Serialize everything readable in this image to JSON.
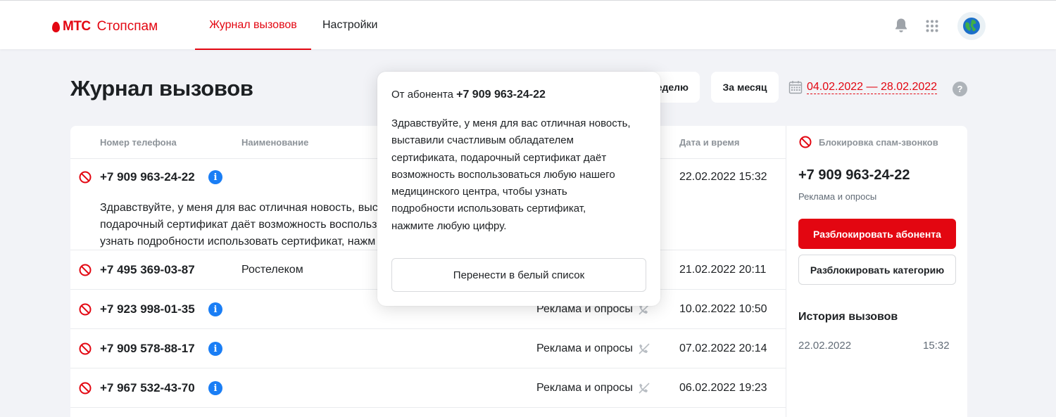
{
  "header": {
    "brand": "МТС",
    "product": "Стопспам",
    "nav": [
      {
        "label": "Журнал вызовов",
        "active": true
      },
      {
        "label": "Настройки",
        "active": false
      }
    ],
    "icons": [
      "bell-icon",
      "apps-grid-icon",
      "globe-avatar-icon"
    ]
  },
  "page": {
    "title": "Журнал вызовов",
    "filters": {
      "week_label": "За неделю",
      "week_label_visible": "еделю",
      "month_label": "За месяц"
    },
    "date_range": "04.02.2022 — 28.02.2022",
    "help": "?"
  },
  "table": {
    "columns": {
      "phone": "Номер телефона",
      "name": "Наименование",
      "datetime": "Дата и время"
    },
    "rows": [
      {
        "phone": "+7 909 963-24-22",
        "name": "",
        "category": "",
        "datetime": "22.02.2022 15:32",
        "transcript_lines": [
          "Здравствуйте, у меня для вас отличная новость, выст",
          "подарочный сертификат даёт возможность воспольз",
          "узнать подробности использовать сертификат, нажм"
        ]
      },
      {
        "phone": "+7 495 369-03-87",
        "name": "Ростелеком",
        "category": "",
        "datetime": "21.02.2022 20:11"
      },
      {
        "phone": "+7 923 998-01-35",
        "name": "",
        "category": "Реклама и опросы",
        "datetime": "10.02.2022 10:50"
      },
      {
        "phone": "+7 909 578-88-17",
        "name": "",
        "category": "Реклама и опросы",
        "datetime": "07.02.2022 20:14"
      },
      {
        "phone": "+7 967 532-43-70",
        "name": "",
        "category": "Реклама и опросы",
        "datetime": "06.02.2022 19:23"
      }
    ]
  },
  "panel": {
    "heading": "Блокировка спам-звонков",
    "phone": "+7 909 963-24-22",
    "category": "Реклама и опросы",
    "unblock_subscriber": "Разблокировать абонента",
    "unblock_category": "Разблокировать категорию",
    "history_title": "История вызовов",
    "history": [
      {
        "date": "22.02.2022",
        "time": "15:32"
      }
    ]
  },
  "popover": {
    "from_label": "От абонента",
    "from_phone": "+7 909 963-24-22",
    "text_lines": [
      "Здравствуйте, у меня для вас отличная новость,",
      "выставили счастливым обладателем",
      "сертификата, подарочный сертификат даёт",
      "возможность воспользоваться любую нашего",
      "медицинского центра, чтобы узнать",
      "подробности использовать сертификат,",
      "нажмите любую цифру."
    ],
    "whitelist_button": "Перенести в белый список"
  },
  "colors": {
    "accent": "#e30611",
    "info": "#1a7ef5",
    "background": "#f2f3f7",
    "muted": "#8d9399"
  }
}
